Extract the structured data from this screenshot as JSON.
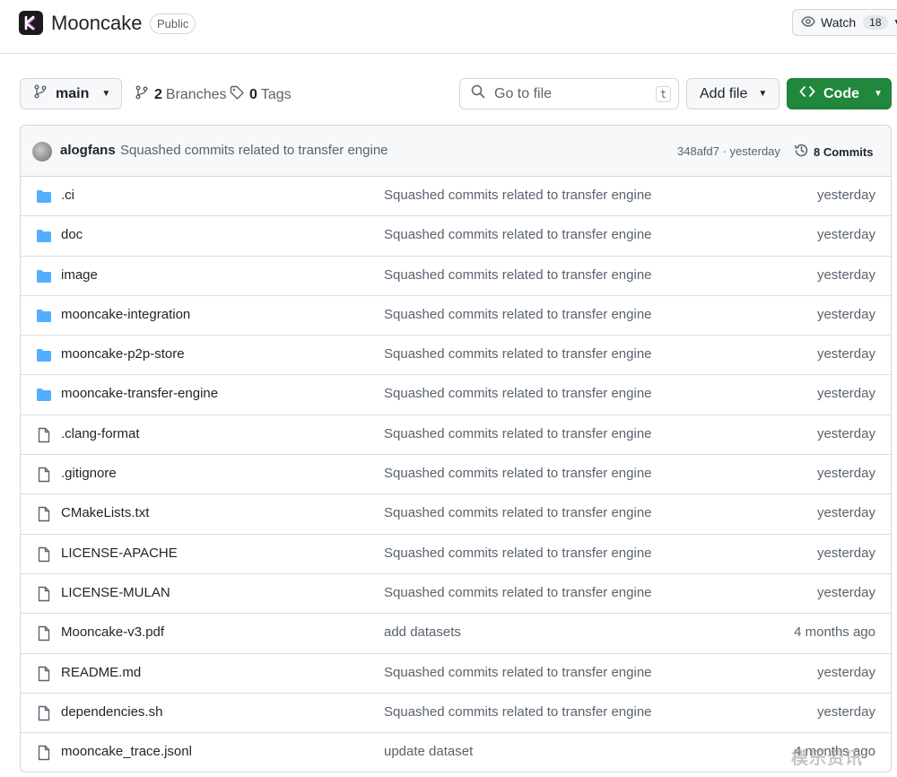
{
  "repo": {
    "name": "Mooncake",
    "visibility": "Public"
  },
  "watch": {
    "label": "Watch",
    "count": "18"
  },
  "toolbar": {
    "branch": "main",
    "branches_count": "2",
    "branches_label": "Branches",
    "tags_count": "0",
    "tags_label": "Tags",
    "search_placeholder": "Go to file",
    "search_shortcut": "t",
    "add_file_label": "Add file",
    "code_label": "Code"
  },
  "latest_commit": {
    "author": "alogfans",
    "message": "Squashed commits related to transfer engine",
    "meta": "348afd7 · yesterday",
    "commits_label": "8 Commits"
  },
  "files": [
    {
      "type": "folder",
      "name": ".ci",
      "message": "Squashed commits related to transfer engine",
      "date": "yesterday"
    },
    {
      "type": "folder",
      "name": "doc",
      "message": "Squashed commits related to transfer engine",
      "date": "yesterday"
    },
    {
      "type": "folder",
      "name": "image",
      "message": "Squashed commits related to transfer engine",
      "date": "yesterday"
    },
    {
      "type": "folder",
      "name": "mooncake-integration",
      "message": "Squashed commits related to transfer engine",
      "date": "yesterday"
    },
    {
      "type": "folder",
      "name": "mooncake-p2p-store",
      "message": "Squashed commits related to transfer engine",
      "date": "yesterday"
    },
    {
      "type": "folder",
      "name": "mooncake-transfer-engine",
      "message": "Squashed commits related to transfer engine",
      "date": "yesterday"
    },
    {
      "type": "file",
      "name": ".clang-format",
      "message": "Squashed commits related to transfer engine",
      "date": "yesterday"
    },
    {
      "type": "file",
      "name": ".gitignore",
      "message": "Squashed commits related to transfer engine",
      "date": "yesterday"
    },
    {
      "type": "file",
      "name": "CMakeLists.txt",
      "message": "Squashed commits related to transfer engine",
      "date": "yesterday"
    },
    {
      "type": "file",
      "name": "LICENSE-APACHE",
      "message": "Squashed commits related to transfer engine",
      "date": "yesterday"
    },
    {
      "type": "file",
      "name": "LICENSE-MULAN",
      "message": "Squashed commits related to transfer engine",
      "date": "yesterday"
    },
    {
      "type": "file",
      "name": "Mooncake-v3.pdf",
      "message": "add datasets",
      "date": "4 months ago"
    },
    {
      "type": "file",
      "name": "README.md",
      "message": "Squashed commits related to transfer engine",
      "date": "yesterday"
    },
    {
      "type": "file",
      "name": "dependencies.sh",
      "message": "Squashed commits related to transfer engine",
      "date": "yesterday"
    },
    {
      "type": "file",
      "name": "mooncake_trace.jsonl",
      "message": "update dataset",
      "date": "4 months ago"
    }
  ],
  "watermark": "模乐资讯",
  "colors": {
    "accent_green": "#1f883d",
    "folder_blue": "#54aeff",
    "muted_text": "#59636e"
  }
}
